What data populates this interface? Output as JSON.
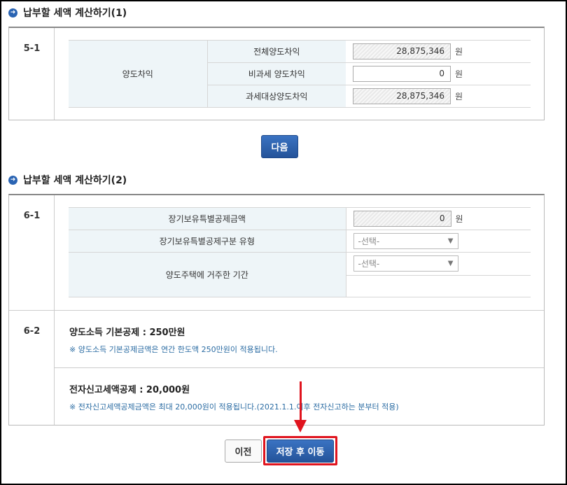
{
  "section1": {
    "title": "납부할 세액 계산하기(1)",
    "number": "5-1",
    "group_label": "양도차익",
    "rows": [
      {
        "label": "전체양도차익",
        "value": "28,875,346",
        "unit": "원"
      },
      {
        "label": "비과세 양도차익",
        "value": "0",
        "unit": "원"
      },
      {
        "label": "과세대상양도차익",
        "value": "28,875,346",
        "unit": "원"
      }
    ]
  },
  "next_button": "다음",
  "section2": {
    "title": "납부할 세액 계산하기(2)",
    "number_a": "6-1",
    "rows": [
      {
        "label": "장기보유특별공제금액",
        "value": "0",
        "unit": "원"
      },
      {
        "label": "장기보유특별공제구분 유형",
        "select": "-선택-"
      },
      {
        "label": "양도주택에 거주한 기간",
        "select": "-선택-"
      }
    ],
    "number_b": "6-2",
    "deductions": [
      {
        "title": "양도소득 기본공제 : 250만원",
        "note": "※ 양도소득 기본공제금액은 연간 한도액 250만원이 적용됩니다."
      },
      {
        "title": "전자신고세액공제 : 20,000원",
        "note": "※ 전자신고세액공제금액은 최대 20,000원이 적용됩니다.(2021.1.1.이후 전자신고하는 분부터 적용)"
      }
    ]
  },
  "buttons": {
    "prev": "이전",
    "save_move": "저장 후 이동"
  },
  "icons": {
    "bullet": "arrow-right-circle-icon",
    "select_chevron": "chevron-down-icon"
  },
  "colors": {
    "accent": "#2a64b3",
    "highlight": "#e0141e",
    "note_text": "#2b6ca3",
    "label_bg": "#eef5f8"
  }
}
